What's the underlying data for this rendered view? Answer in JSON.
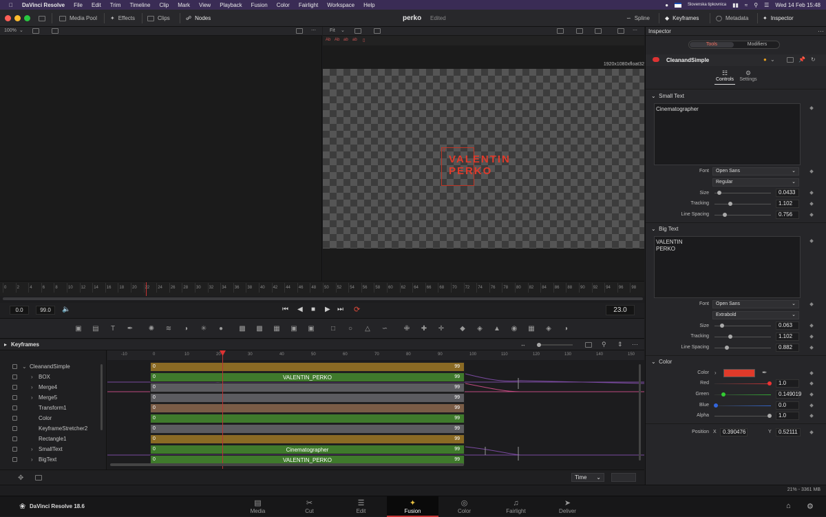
{
  "menubar": {
    "app": "DaVinci Resolve",
    "items": [
      "File",
      "Edit",
      "Trim",
      "Timeline",
      "Clip",
      "Mark",
      "View",
      "Playback",
      "Fusion",
      "Color",
      "Fairlight",
      "Workspace",
      "Help"
    ],
    "keyboard": "Slovenska tipkovnica",
    "datetime": "Wed 14 Feb  15:48"
  },
  "toolbar": {
    "media_pool": "Media Pool",
    "effects": "Effects",
    "clips": "Clips",
    "nodes": "Nodes",
    "project": "perko",
    "status": "Edited",
    "spline": "Spline",
    "keyframes": "Keyframes",
    "metadata": "Metadata",
    "inspector": "Inspector"
  },
  "viewer": {
    "left_zoom": "100%",
    "right_fit": "Fit",
    "resolution": "1920x1080xfloat32",
    "title_line1": "VALENTIN",
    "title_line2": "PERKO",
    "title_color": "#e03a2a",
    "view_labels": [
      "Ab",
      "Ab",
      "ab",
      "ab"
    ]
  },
  "ruler": {
    "ticks": [
      "0",
      "2",
      "4",
      "6",
      "8",
      "10",
      "12",
      "14",
      "16",
      "18",
      "20",
      "22",
      "24",
      "26",
      "28",
      "30",
      "32",
      "34",
      "36",
      "38",
      "40",
      "42",
      "44",
      "46",
      "48",
      "50",
      "52",
      "54",
      "56",
      "58",
      "60",
      "62",
      "64",
      "66",
      "68",
      "70",
      "72",
      "74",
      "76",
      "78",
      "80",
      "82",
      "84",
      "86",
      "88",
      "90",
      "92",
      "94",
      "96",
      "98"
    ]
  },
  "transport": {
    "start": "0.0",
    "end": "99.0",
    "current": "23.0"
  },
  "keyframes": {
    "title": "Keyframes",
    "axis": [
      "-10",
      "0",
      "10",
      "20",
      "30",
      "40",
      "50",
      "60",
      "70",
      "80",
      "90",
      "100",
      "110",
      "120",
      "130",
      "140",
      "150"
    ],
    "tree": [
      "CleanandSimple",
      "BOX",
      "Merge4",
      "Merge5",
      "Transform1",
      "Color",
      "KeyframeStretcher2",
      "Rectangle1",
      "SmallText",
      "BigText"
    ],
    "bars": [
      {
        "start": "0",
        "end": "99",
        "label": "",
        "color": "#8a6a24"
      },
      {
        "start": "0",
        "end": "99",
        "label": "VALENTIN_PERKO",
        "color": "#3f7a2c"
      },
      {
        "start": "0",
        "end": "99",
        "label": "",
        "color": "#5c5c60"
      },
      {
        "start": "0",
        "end": "99",
        "label": "",
        "color": "#5c5c60"
      },
      {
        "start": "0",
        "end": "99",
        "label": "",
        "color": "#7a5c46"
      },
      {
        "start": "0",
        "end": "99",
        "label": "",
        "color": "#3f7a2c"
      },
      {
        "start": "0",
        "end": "99",
        "label": "",
        "color": "#5c5c60"
      },
      {
        "start": "0",
        "end": "99",
        "label": "",
        "color": "#8a6a24"
      },
      {
        "start": "0",
        "end": "99",
        "label": "Cinematographer",
        "color": "#3f7a2c"
      },
      {
        "start": "0",
        "end": "99",
        "label": "VALENTIN_PERKO",
        "color": "#3f7a2c"
      }
    ],
    "time_mode": "Time"
  },
  "inspector": {
    "title": "Inspector",
    "tab_tools": "Tools",
    "tab_modifiers": "Modifiers",
    "node_name": "CleanandSimple",
    "subtab_controls": "Controls",
    "subtab_settings": "Settings",
    "small_text": {
      "section": "Small Text",
      "text": "Cinematographer",
      "font_label": "Font",
      "font": "Open Sans",
      "style": "Regular",
      "size_label": "Size",
      "size": "0.0433",
      "tracking_label": "Tracking",
      "tracking": "1.102",
      "spacing_label": "Line Spacing",
      "spacing": "0.756"
    },
    "big_text": {
      "section": "Big Text",
      "text": "VALENTIN\nPERKO",
      "font_label": "Font",
      "font": "Open Sans",
      "style": "Extrabold",
      "size_label": "Size",
      "size": "0.063",
      "tracking_label": "Tracking",
      "tracking": "1.102",
      "spacing_label": "Line Spacing",
      "spacing": "0.882"
    },
    "color": {
      "section": "Color",
      "color_label": "Color",
      "swatch": "#e03a2a",
      "red_label": "Red",
      "red": "1.0",
      "green_label": "Green",
      "green": "0.149019",
      "blue_label": "Blue",
      "blue": "0.0",
      "alpha_label": "Alpha",
      "alpha": "1.0"
    },
    "position": {
      "label": "Position",
      "x_label": "X",
      "x": "0.390476",
      "y_label": "Y",
      "y": "0.52111"
    }
  },
  "status": {
    "memory": "21% - 3361 MB"
  },
  "footer": {
    "brand": "DaVinci Resolve 18.6",
    "pages": [
      "Media",
      "Cut",
      "Edit",
      "Fusion",
      "Color",
      "Fairlight",
      "Deliver"
    ],
    "active": "Fusion"
  }
}
